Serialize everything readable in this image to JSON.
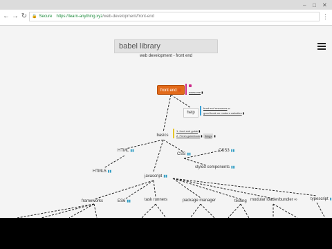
{
  "browser": {
    "secure_label": "Secure",
    "url_host": "https://learn-anything.xyz",
    "url_path": "/web-development/front-end",
    "menu_icon": "more-vert-icon"
  },
  "app": {
    "search_value": "babel library",
    "subtitle": "web development - front end",
    "menu_icon": "hamburger-icon"
  },
  "map": {
    "root": "front end",
    "root_resources": [
      "awesome"
    ],
    "help": "help",
    "help_resources": [
      "front end resources",
      "good book on modern websites"
    ],
    "basics": "basics",
    "basics_resources": [
      "1. front end guide",
      "2. Fresh guidebook",
      "things"
    ],
    "nodes": {
      "html": "HTML",
      "html5": "HTML5",
      "css": "CSS",
      "css3": "CSS3",
      "styled_components": "styled components",
      "javascript": "javascript",
      "frameworks": "frameworks",
      "es6": "ES6",
      "task_runners": "task runners",
      "package_manager": "package manager",
      "testing": "testing",
      "module_bundler": "modular loader/bundler",
      "typescript": "typescript"
    }
  }
}
